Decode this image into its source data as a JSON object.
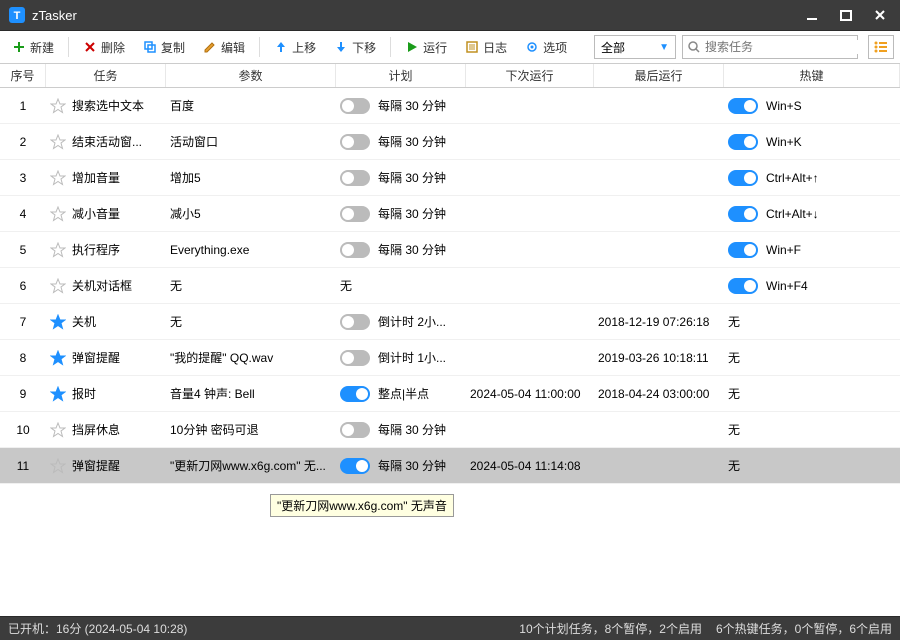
{
  "window": {
    "title": "zTasker"
  },
  "toolbar": {
    "new": "新建",
    "delete": "删除",
    "copy": "复制",
    "edit": "编辑",
    "up": "上移",
    "down": "下移",
    "run": "运行",
    "log": "日志",
    "options": "选项"
  },
  "filter": {
    "selected": "全部"
  },
  "search": {
    "placeholder": "搜索任务"
  },
  "columns": {
    "idx": "序号",
    "task": "任务",
    "param": "参数",
    "plan": "计划",
    "next": "下次运行",
    "last": "最后运行",
    "hot": "热键"
  },
  "rows": [
    {
      "idx": "1",
      "fav": false,
      "task": "搜索选中文本",
      "param": "百度",
      "enabled": false,
      "plan": "每隔 30 分钟",
      "next": "",
      "last": "",
      "hotOn": true,
      "hot": "Win+S"
    },
    {
      "idx": "2",
      "fav": false,
      "task": "结束活动窗...",
      "param": "活动窗口",
      "enabled": false,
      "plan": "每隔 30 分钟",
      "next": "",
      "last": "",
      "hotOn": true,
      "hot": "Win+K"
    },
    {
      "idx": "3",
      "fav": false,
      "task": "增加音量",
      "param": "增加5",
      "enabled": false,
      "plan": "每隔 30 分钟",
      "next": "",
      "last": "",
      "hotOn": true,
      "hot": "Ctrl+Alt+↑"
    },
    {
      "idx": "4",
      "fav": false,
      "task": "减小音量",
      "param": "减小5",
      "enabled": false,
      "plan": "每隔 30 分钟",
      "next": "",
      "last": "",
      "hotOn": true,
      "hot": "Ctrl+Alt+↓"
    },
    {
      "idx": "5",
      "fav": false,
      "task": "执行程序",
      "param": "Everything.exe",
      "enabled": false,
      "plan": "每隔 30 分钟",
      "next": "",
      "last": "",
      "hotOn": true,
      "hot": "Win+F"
    },
    {
      "idx": "6",
      "fav": false,
      "task": "关机对话框",
      "param": "无",
      "enabled": false,
      "plan": "无",
      "noToggle": true,
      "next": "",
      "last": "",
      "hotOn": true,
      "hot": "Win+F4"
    },
    {
      "idx": "7",
      "fav": true,
      "task": "关机",
      "param": "无",
      "enabled": false,
      "plan": "倒计时 2小...",
      "next": "",
      "last": "2018-12-19 07:26:18",
      "hotOn": false,
      "hot": "无",
      "noHotToggle": true
    },
    {
      "idx": "8",
      "fav": true,
      "task": "弹窗提醒",
      "param": "\"我的提醒\" QQ.wav",
      "enabled": false,
      "plan": "倒计时 1小...",
      "next": "",
      "last": "2019-03-26 10:18:11",
      "hotOn": false,
      "hot": "无",
      "noHotToggle": true
    },
    {
      "idx": "9",
      "fav": true,
      "task": "报时",
      "param": "音量4 钟声: Bell",
      "enabled": true,
      "plan": "整点|半点",
      "next": "2024-05-04 11:00:00",
      "last": "2018-04-24 03:00:00",
      "hotOn": false,
      "hot": "无",
      "noHotToggle": true
    },
    {
      "idx": "10",
      "fav": false,
      "task": "挡屏休息",
      "param": "10分钟 密码可退",
      "enabled": false,
      "plan": "每隔 30 分钟",
      "next": "",
      "last": "",
      "hotOn": false,
      "hot": "无",
      "noHotToggle": true
    },
    {
      "idx": "11",
      "fav": false,
      "task": "弹窗提醒",
      "param": "\"更新刀网www.x6g.com\" 无...",
      "enabled": true,
      "plan": "每隔 30 分钟",
      "next": "2024-05-04 11:14:08",
      "last": "",
      "hotOn": false,
      "hot": "无",
      "noHotToggle": true,
      "selected": true
    }
  ],
  "tooltip": "\"更新刀网www.x6g.com\" 无声音",
  "status": {
    "left": "已开机：16分 (2024-05-04 10:28)",
    "right1": "10个计划任务，8个暂停，2个启用",
    "right2": "6个热键任务，0个暂停，6个启用"
  }
}
